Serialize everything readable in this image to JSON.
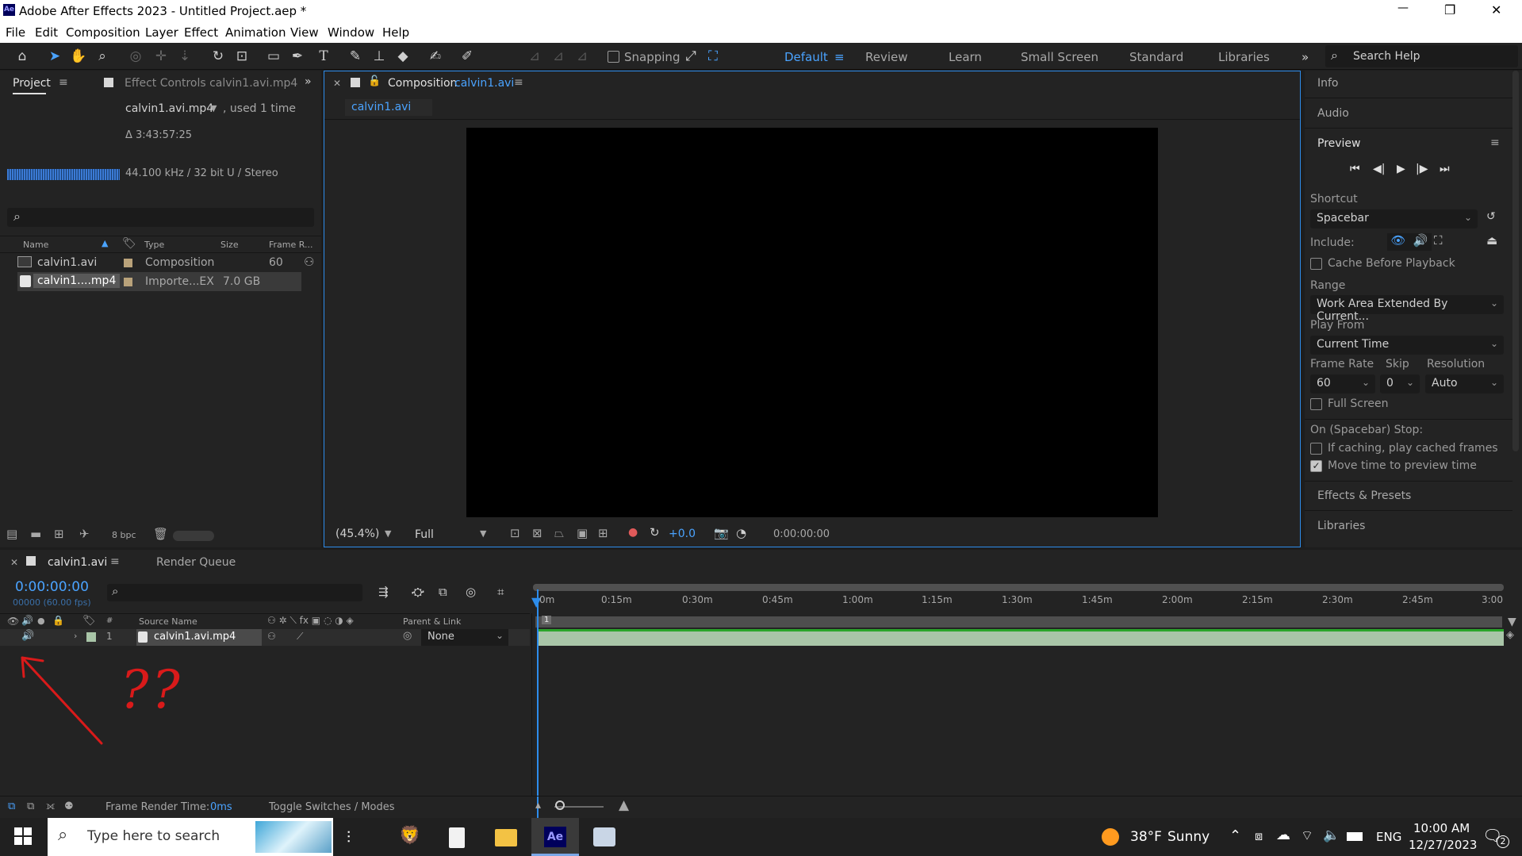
{
  "app": {
    "title": "Adobe After Effects 2023 - Untitled Project.aep *",
    "icon_text": "Ae"
  },
  "window_controls": {
    "minimize": "—",
    "maximize": "❐",
    "close": "✕"
  },
  "menu": [
    "File",
    "Edit",
    "Composition",
    "Layer",
    "Effect",
    "Animation",
    "View",
    "Window",
    "Help"
  ],
  "toolbar": {
    "snapping_label": "Snapping",
    "workspaces": [
      "Default",
      "Review",
      "Learn",
      "Small Screen",
      "Standard",
      "Libraries"
    ],
    "active_workspace": "Default",
    "search_placeholder": "Search Help"
  },
  "project_panel": {
    "tab_project": "Project",
    "tab_effect_controls": "Effect Controls calvin1.avi.mp4",
    "selected_name": "calvin1.avi.mp4",
    "used": ", used 1 time",
    "duration": "Δ 3:43:57:25",
    "audio_info": "44.100 kHz / 32 bit U / Stereo",
    "search_icon_glyph": "⌕",
    "columns": [
      "Name",
      "Type",
      "Size",
      "Frame R..."
    ],
    "rows": [
      {
        "name": "calvin1.avi",
        "type": "Composition",
        "size": "",
        "frame_rate": "60",
        "label_color": "#b9a27a"
      },
      {
        "name": "calvin1....mp4",
        "type": "Importe...EX",
        "size": "7.0 GB",
        "frame_rate": "",
        "label_color": "#b9a27a"
      }
    ],
    "bpc": "8 bpc"
  },
  "composition_panel": {
    "tab_prefix": "Composition",
    "tab_comp_name": "calvin1.avi",
    "sub_tab": "calvin1.avi",
    "zoom": "(45.4%)",
    "resolution": "Full",
    "exposure": "+0.0",
    "timecode": "0:00:00:00"
  },
  "right_panel": {
    "info": "Info",
    "audio": "Audio",
    "preview": "Preview",
    "shortcut_label": "Shortcut",
    "shortcut_value": "Spacebar",
    "include_label": "Include:",
    "cache_before_playback": "Cache Before Playback",
    "range_label": "Range",
    "range_value": "Work Area Extended By Current...",
    "play_from_label": "Play From",
    "play_from_value": "Current Time",
    "frame_rate_label": "Frame Rate",
    "skip_label": "Skip",
    "resolution_label": "Resolution",
    "frame_rate_value": "60",
    "skip_value": "0",
    "resolution_value": "Auto",
    "full_screen": "Full Screen",
    "on_stop_label": "On (Spacebar) Stop:",
    "if_caching": "If caching, play cached frames",
    "move_time": "Move time to preview time",
    "move_time_checked": true,
    "effects_presets": "Effects & Presets",
    "libraries": "Libraries"
  },
  "timeline": {
    "tab_comp": "calvin1.avi",
    "tab_render_queue": "Render Queue",
    "timecode": "0:00:00:00",
    "frame_info": "00000 (60.00 fps)",
    "col_hash": "#",
    "col_source_name": "Source Name",
    "col_parent": "Parent & Link",
    "ruler_labels": [
      "0m",
      "0:15m",
      "0:30m",
      "0:45m",
      "1:00m",
      "1:15m",
      "1:30m",
      "1:45m",
      "2:00m",
      "2:15m",
      "2:30m",
      "2:45m",
      "3:00"
    ],
    "layer": {
      "number": "1",
      "name": "calvin1.avi.mp4",
      "parent": "None"
    },
    "work_marker": "1",
    "frame_render_label": "Frame Render Time:",
    "frame_render_value": "0ms",
    "toggle_label": "Toggle Switches / Modes",
    "annotation_text": "??",
    "track_color": "#a9c5a8"
  },
  "taskbar": {
    "search_placeholder": "Type here to search",
    "weather_temp": "38°F",
    "weather_cond": "Sunny",
    "lang": "ENG",
    "time": "10:00 AM",
    "date": "12/27/2023",
    "notifications": "2",
    "ae_label": "Ae"
  }
}
